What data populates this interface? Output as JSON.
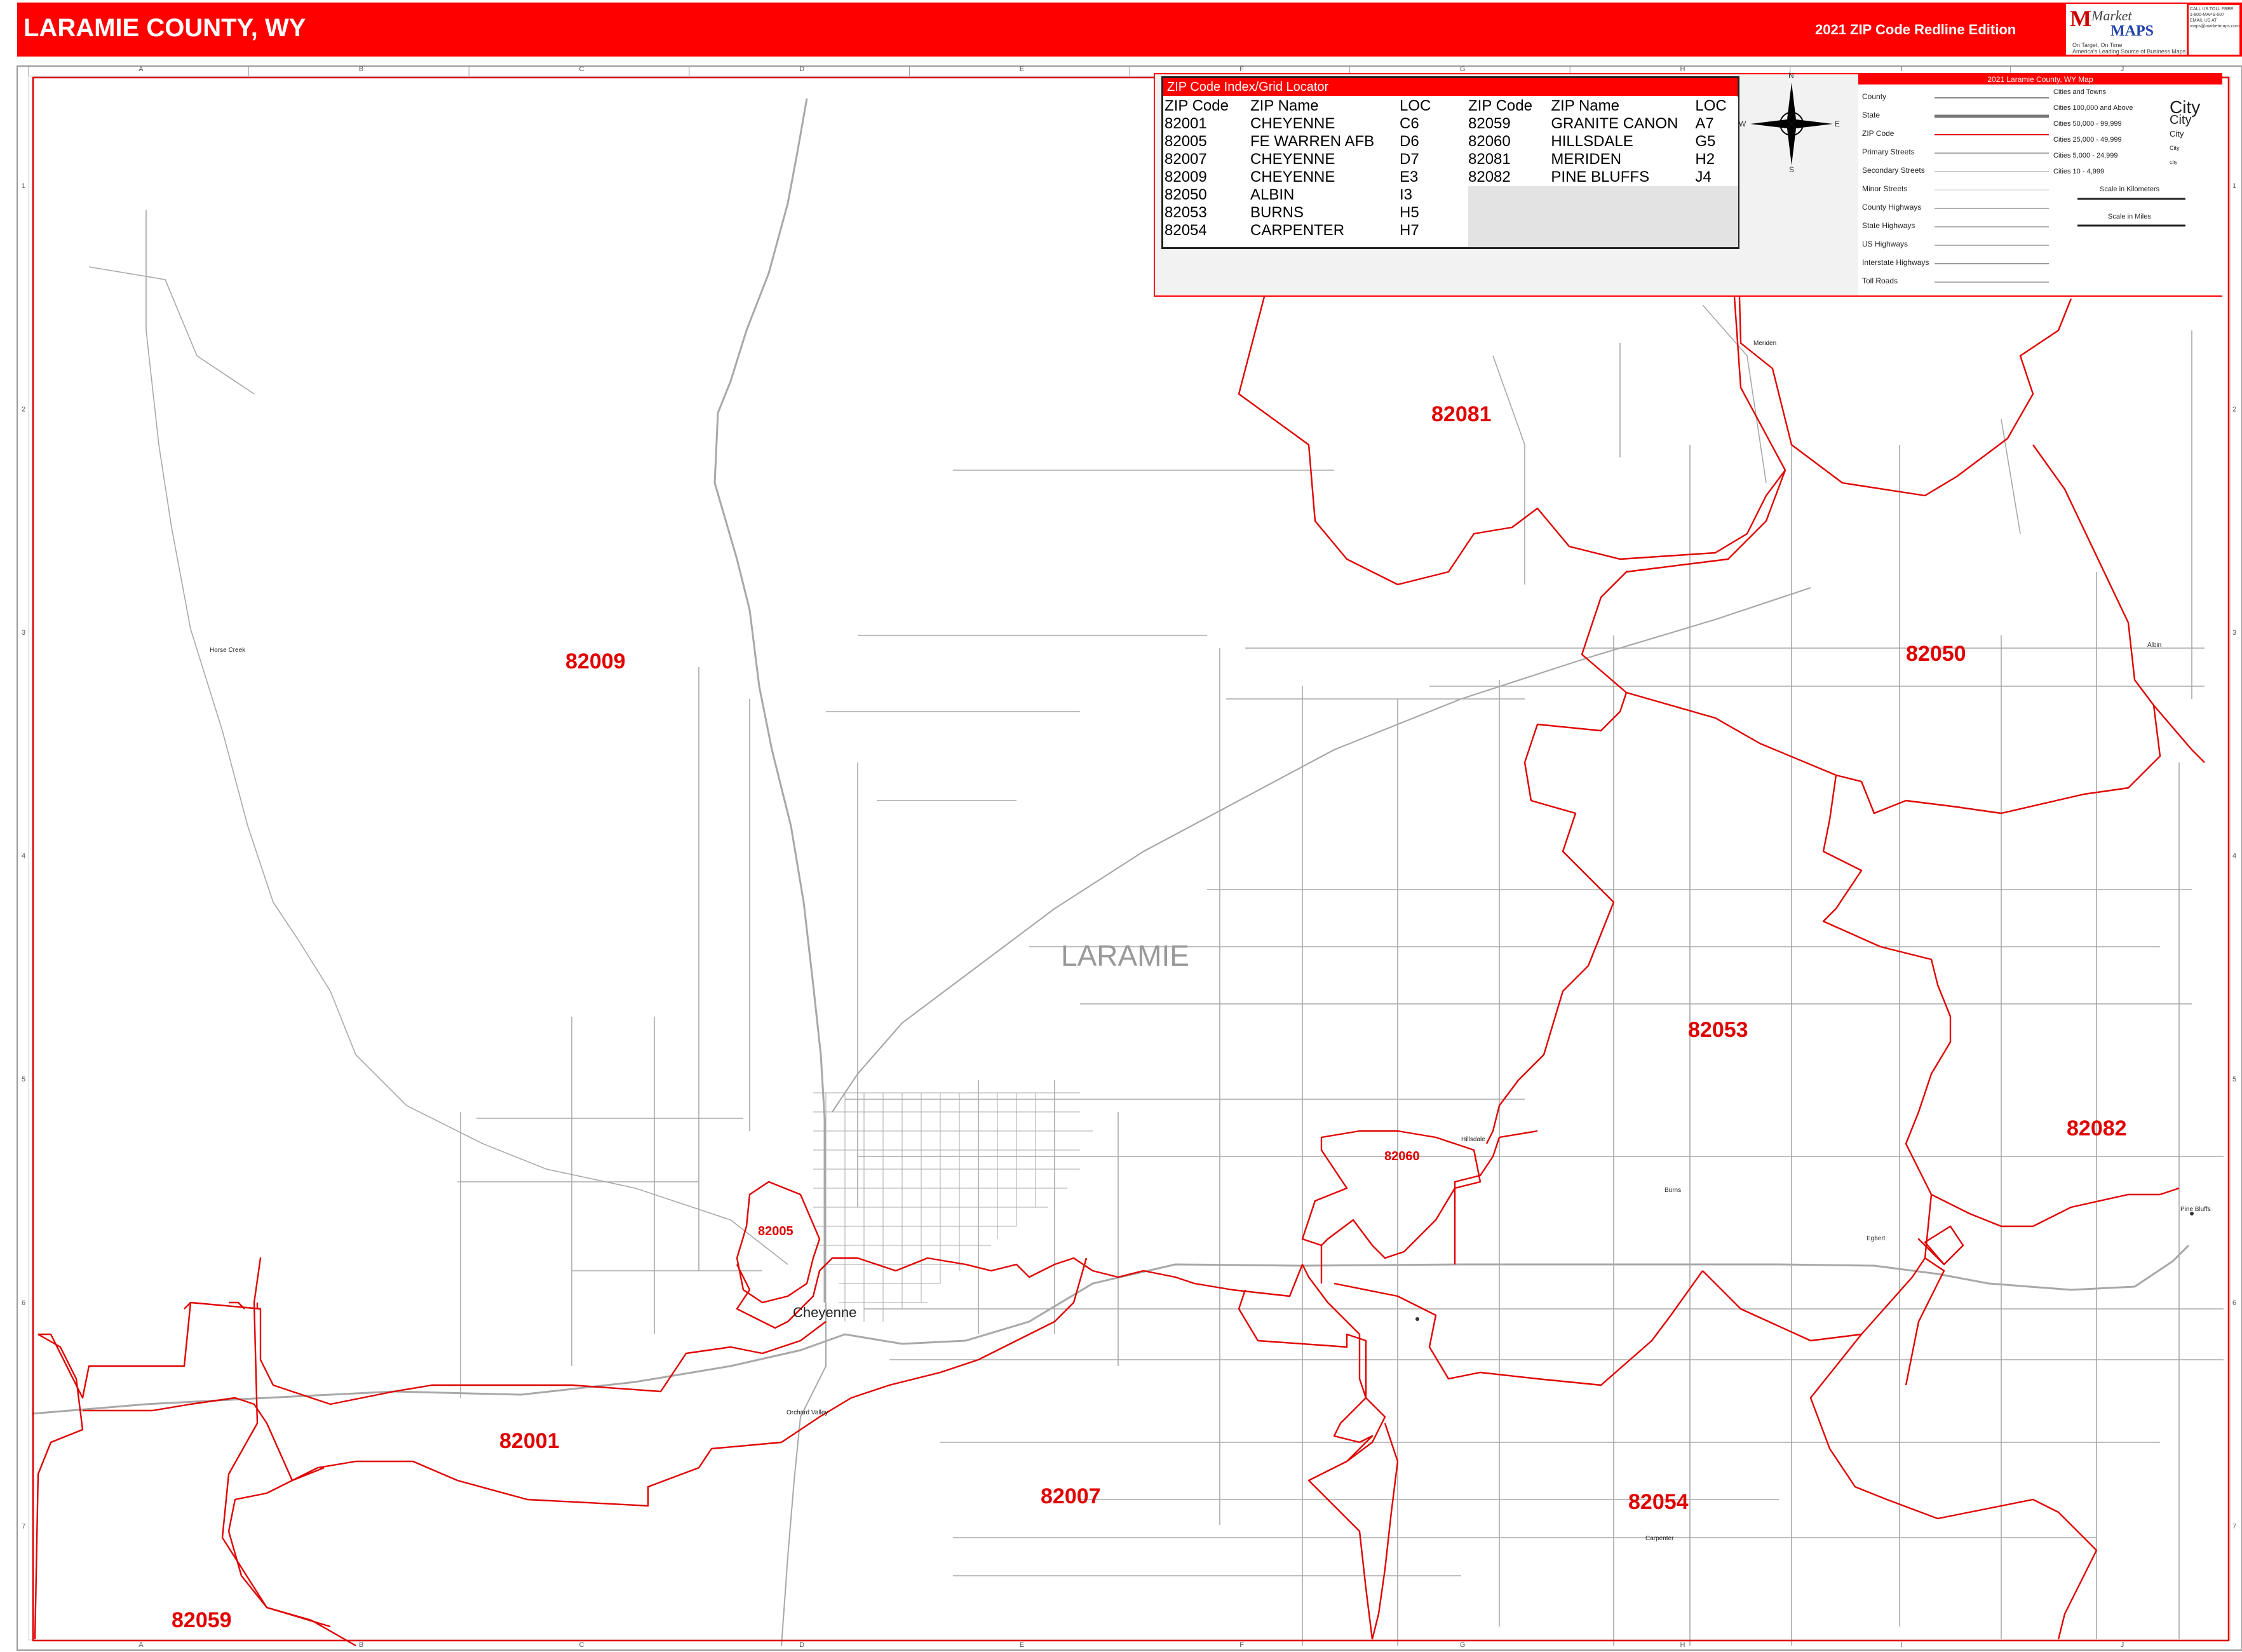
{
  "header": {
    "title": "LARAMIE COUNTY, WY",
    "edition": "2021 ZIP Code Redline Edition",
    "logo": {
      "brand_market": "Market",
      "brand_maps": "MAPS",
      "tagline_line1": "On Target, On Time",
      "tagline_line2": "America's Leading Source of Business Maps",
      "contact_lines": [
        "CALL US TOLL FREE",
        "1-800-MAPS-007",
        "EMAIL US AT",
        "maps@marketmaps.com"
      ]
    }
  },
  "zip_index": {
    "title": "ZIP Code Index/Grid Locator",
    "columns": [
      "ZIP Code",
      "ZIP Name",
      "LOC"
    ],
    "left_rows": [
      [
        "82001",
        "CHEYENNE",
        "C6"
      ],
      [
        "82005",
        "FE WARREN AFB",
        "D6"
      ],
      [
        "82007",
        "CHEYENNE",
        "D7"
      ],
      [
        "82009",
        "CHEYENNE",
        "E3"
      ],
      [
        "82050",
        "ALBIN",
        "I3"
      ],
      [
        "82053",
        "BURNS",
        "H5"
      ],
      [
        "82054",
        "CARPENTER",
        "H7"
      ]
    ],
    "right_rows": [
      [
        "82059",
        "GRANITE CANON",
        "A7"
      ],
      [
        "82060",
        "HILLSDALE",
        "G5"
      ],
      [
        "82081",
        "MERIDEN",
        "H2"
      ],
      [
        "82082",
        "PINE BLUFFS",
        "J4"
      ]
    ]
  },
  "compass": {
    "n": "N",
    "s": "S",
    "e": "E",
    "w": "W"
  },
  "legend": {
    "title": "2021 Laramie County, WY Map",
    "left_items": [
      "County",
      "State",
      "ZIP Code",
      "Primary Streets",
      "Secondary Streets",
      "Minor Streets",
      "County Highways",
      "State Highways",
      "US Highways",
      "Interstate Highways",
      "Toll Roads"
    ],
    "right_items": [
      "Cities and Towns",
      "Cities 100,000 and Above",
      "Cities 50,000 - 99,999",
      "Cities 25,000 - 49,999",
      "Cities 5,000 - 24,999",
      "Cities 10 - 4,999"
    ],
    "city_samples": [
      "City",
      "City",
      "City",
      "City",
      "City"
    ],
    "scale_km": "Scale in Kilometers",
    "scale_mi": "Scale in Miles"
  },
  "grid": {
    "columns": [
      "A",
      "B",
      "C",
      "D",
      "E",
      "F",
      "G",
      "H",
      "I",
      "J"
    ],
    "rows": [
      "1",
      "2",
      "3",
      "4",
      "5",
      "6",
      "7"
    ]
  },
  "map": {
    "county_name": "LARAMIE",
    "county_name_fragment": "N",
    "zip_labels": [
      "82009",
      "82081",
      "82050",
      "82053",
      "82082",
      "82060",
      "82005",
      "82001",
      "82007",
      "82054",
      "82059"
    ],
    "cities": [
      "Cheyenne",
      "Burns",
      "Hillsdale",
      "Carpenter",
      "Pine Bluffs",
      "Albin",
      "Meriden",
      "Egbert",
      "Horse Creek",
      "Orchard Valley"
    ],
    "colors": {
      "zip_boundary": "#e00000",
      "roads": "#9a9a9a",
      "header": "#ff0000"
    }
  }
}
